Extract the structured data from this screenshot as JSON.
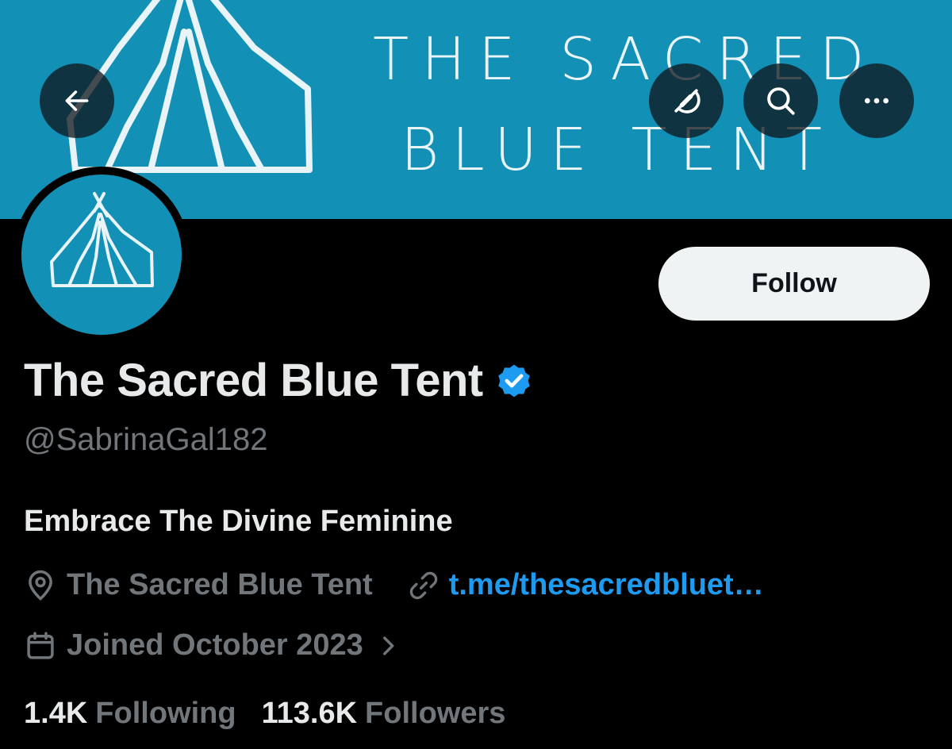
{
  "banner": {
    "line1": "THE SACRED",
    "line2": "BLUE TENT"
  },
  "header": {
    "back_icon": "arrow-left-icon",
    "grok_icon": "grok-icon",
    "search_icon": "search-icon",
    "more_icon": "more-horizontal-icon"
  },
  "profile": {
    "display_name": "The Sacred Blue Tent",
    "verified": true,
    "handle": "@SabrinaGal182",
    "bio": "Embrace The Divine Feminine",
    "location": "The Sacred Blue Tent",
    "link": "t.me/thesacredbluet…",
    "joined": "Joined October 2023",
    "follow_label": "Follow"
  },
  "stats": {
    "following_count": "1.4K",
    "following_label": "Following",
    "followers_count": "113.6K",
    "followers_label": "Followers"
  },
  "colors": {
    "banner": "#1390b5",
    "accent": "#1d9bf0",
    "muted": "#71767b",
    "text": "#e7e9ea"
  }
}
